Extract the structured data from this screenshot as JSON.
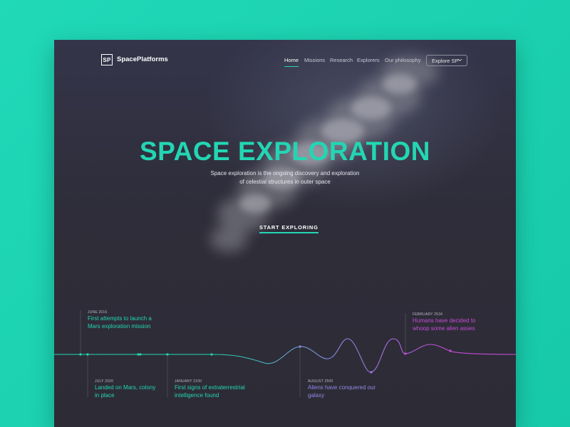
{
  "brand": {
    "logo_mark": "SP",
    "name": "SpacePlatforms"
  },
  "nav": {
    "items": [
      {
        "label": "Home",
        "active": true
      },
      {
        "label": "Missions",
        "active": false
      },
      {
        "label": "Research",
        "active": false
      },
      {
        "label": "Explorers",
        "active": false
      },
      {
        "label": "Our philosophy",
        "active": false
      }
    ],
    "explore_button": "Explore SP",
    "explore_icon": "chevron-down-icon"
  },
  "hero": {
    "title": "SPACE EXPLORATION",
    "subtitle_line1": "Space exploration is the ongoing discovery and exploration",
    "subtitle_line2": "of celestial structures in outer space",
    "cta": "START EXPLORING"
  },
  "timeline": {
    "events": [
      {
        "date": "JUNE 2016",
        "line1": "First attempts to launch a",
        "line2": "Mars exploration mission"
      },
      {
        "date": "JULY 2020",
        "line1": "Landed on Mars, colony",
        "line2": "in place"
      },
      {
        "date": "JANUARY 2100",
        "line1": "First signs of extraterrestrial",
        "line2": "intelligence found"
      },
      {
        "date": "AUGUST 2500",
        "line1": "Aliens have conquered our",
        "line2": "galaxy"
      },
      {
        "date": "FEBRUARY 2534",
        "line1": "Humans have decided to",
        "line2": "whoop some alien asses"
      }
    ]
  },
  "colors": {
    "accent": "#23d6b3",
    "background": "#2d2c36",
    "page": "#1fd5b5",
    "timeline_mid": "#8f88e6",
    "timeline_end": "#c64cd6"
  }
}
